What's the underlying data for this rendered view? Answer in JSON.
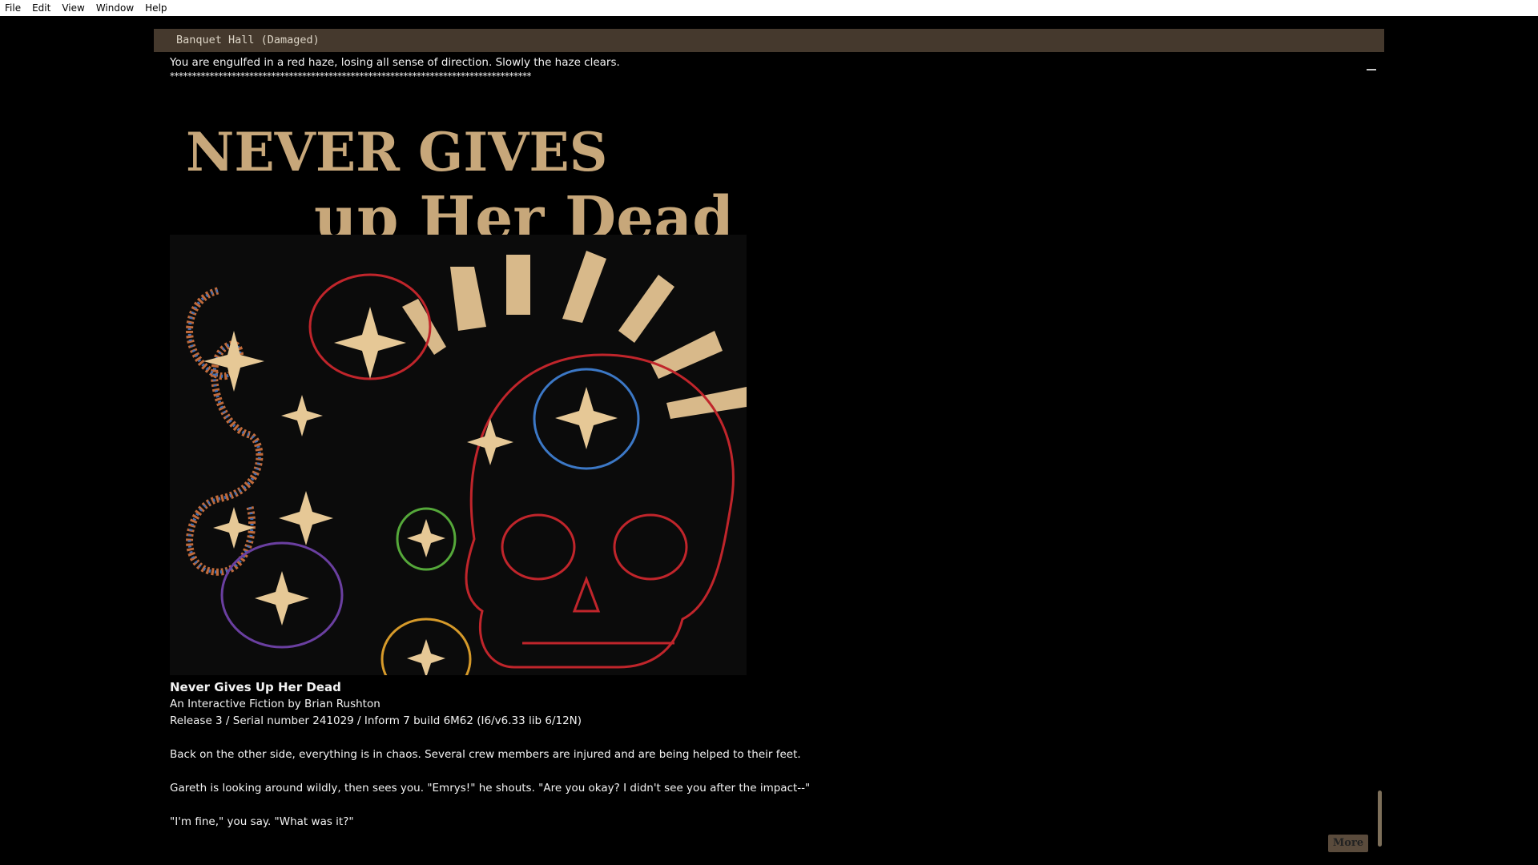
{
  "menu": [
    "File",
    "Edit",
    "View",
    "Window",
    "Help"
  ],
  "status_bar": {
    "location": "Banquet Hall (Damaged)"
  },
  "story": {
    "haze_line": "You are engulfed in a red haze, losing all sense of direction. Slowly the haze clears.",
    "separator": "**********************************************************************************",
    "cover": {
      "title_line1": "NEVER GIVES",
      "title_line2": "up Her Dead"
    },
    "game_title": "Never Gives Up Her Dead",
    "byline": "An Interactive Fiction by Brian Rushton",
    "release": "Release 3 / Serial number 241029 / Inform 7 build 6M62 (I6/v6.33 lib 6/12N)",
    "paragraph1": "Back on the other side, everything is in chaos. Several crew members are injured and are being helped to their feet.",
    "paragraph2": "Gareth is looking around wildly, then sees you. \"Emrys!\" he shouts. \"Are you okay? I didn't see you after the impact--\"",
    "paragraph3": "\"I'm fine,\" you say. \"What was it?\""
  },
  "more_button": "More",
  "colors": {
    "status_bg": "#45392d",
    "title_gold": "#c7a77a",
    "background": "#000000"
  }
}
